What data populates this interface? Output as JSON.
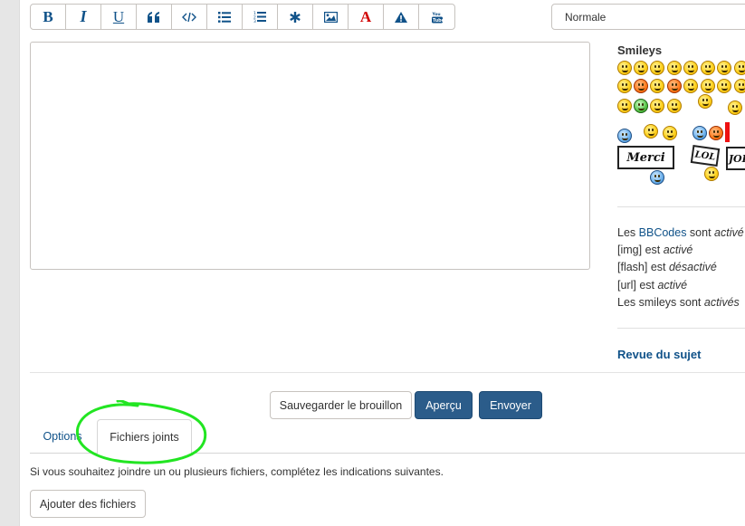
{
  "toolbar": {
    "bold": "B",
    "italic": "I",
    "underline": "U",
    "quote_icon": "quote-icon",
    "code_icon": "code-icon",
    "list_icon": "list-icon",
    "ordered_list_icon": "ordered-list-icon",
    "asterisk_icon": "asterisk-icon",
    "image_icon": "image-icon",
    "color": "A",
    "warning_icon": "warning-icon",
    "youtube_icon": "youtube-icon",
    "accent": "#105289"
  },
  "font_size": {
    "selected": "Normale"
  },
  "sidebar": {
    "smileys_title": "Smileys",
    "signs": {
      "merci": "Merci",
      "lol": "LOL",
      "jok": "JOK"
    },
    "options": {
      "bbcode_prefix": "Les ",
      "bbcode_link": "BBCodes",
      "bbcode_middle": " sont ",
      "bbcode_state": "activé",
      "img_label": "[img]",
      "img_middle": " est ",
      "img_state": "activé",
      "flash_label": "[flash]",
      "flash_middle": " est ",
      "flash_state": "désactivé",
      "url_label": "[url]",
      "url_middle": " est ",
      "url_state": "activé",
      "smileys_prefix": "Les smileys sont ",
      "smileys_state": "activés"
    },
    "revue": "Revue du sujet"
  },
  "buttons": {
    "save_draft": "Sauvegarder le brouillon",
    "preview": "Aperçu",
    "submit": "Envoyer",
    "primary_color": "#2b5c8a"
  },
  "tabs": [
    {
      "label": "Options",
      "active": false
    },
    {
      "label": "Fichiers joints",
      "active": true
    }
  ],
  "attachments": {
    "help": "Si vous souhaitez joindre un ou plusieurs fichiers, complétez les indications suivantes.",
    "add_button": "Ajouter des fichiers"
  },
  "annotation": {
    "color": "#22e522"
  }
}
